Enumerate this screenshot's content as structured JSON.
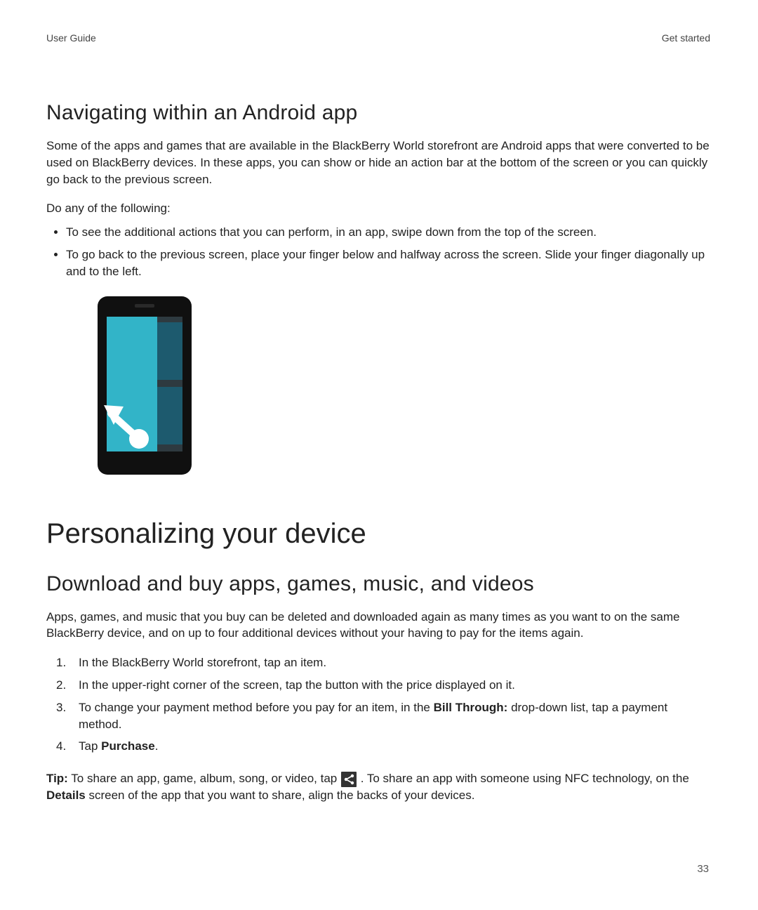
{
  "header": {
    "left": "User Guide",
    "right": "Get started"
  },
  "section1": {
    "title": "Navigating within an Android app",
    "intro": "Some of the apps and games that are available in the BlackBerry World storefront are Android apps that were converted to be used on BlackBerry devices. In these apps, you can show or hide an action bar at the bottom of the screen or you can quickly go back to the previous screen.",
    "lead": "Do any of the following:",
    "bullets": [
      "To see the additional actions that you can perform, in an app, swipe down from the top of the screen.",
      "To go back to the previous screen, place your finger below and halfway across the screen. Slide your finger diagonally up and to the left."
    ]
  },
  "chapter": {
    "title": "Personalizing your device"
  },
  "section2": {
    "title": "Download and buy apps, games, music, and videos",
    "intro": "Apps, games, and music that you buy can be deleted and downloaded again as many times as you want to on the same BlackBerry device, and on up to four additional devices without your having to pay for the items again.",
    "steps": [
      {
        "n": "1.",
        "text": "In the BlackBerry World storefront, tap an item."
      },
      {
        "n": "2.",
        "text": "In the upper-right corner of the screen, tap the button with the price displayed on it."
      },
      {
        "n": "3.",
        "pre": "To change your payment method before you pay for an item, in the ",
        "bold": "Bill Through:",
        "post": " drop-down list, tap a payment method."
      },
      {
        "n": "4.",
        "pre": "Tap ",
        "bold": "Purchase",
        "post": "."
      }
    ],
    "tip": {
      "label": "Tip:",
      "pre": " To share an app, game, album, song, or video, tap ",
      "mid": " . To share an app with someone using NFC technology, on the ",
      "bold": "Details",
      "post": " screen of the app that you want to share, align the backs of your devices."
    }
  },
  "pageNumber": "33"
}
